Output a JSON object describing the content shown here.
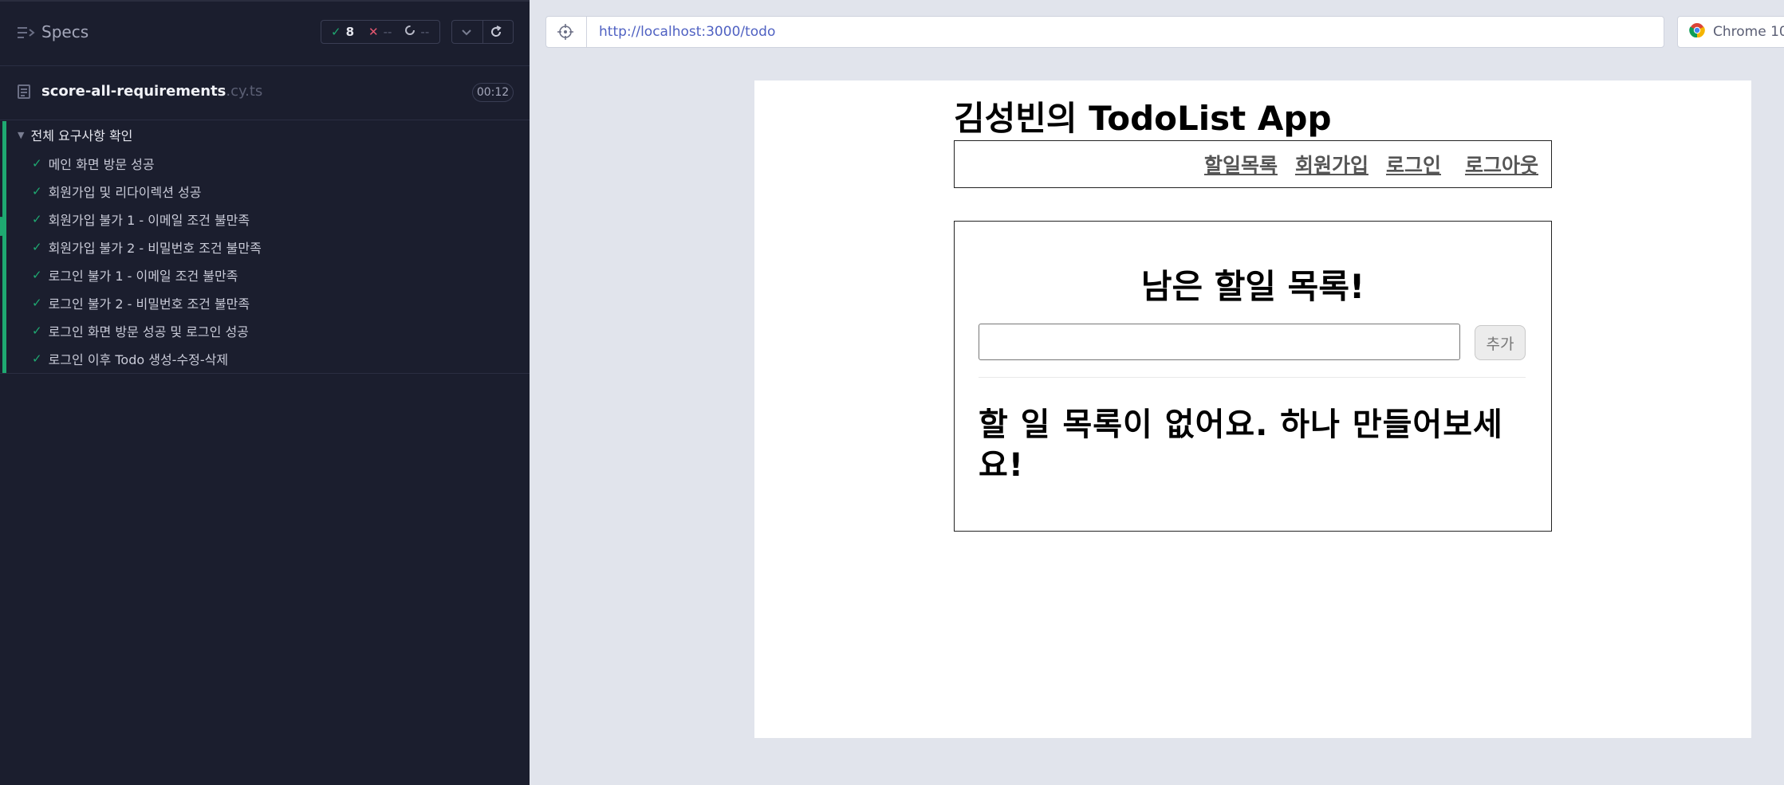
{
  "runner": {
    "specs_title": "Specs",
    "stats": {
      "passed": "8",
      "failed": "--",
      "pending": "--"
    },
    "spec_file": {
      "name": "score-all-requirements",
      "ext": ".cy.ts",
      "duration": "00:12"
    },
    "suite": {
      "title": "전체 요구사항 확인",
      "tests": [
        "메인 화면 방문 성공",
        "회원가입 및 리다이렉션 성공",
        "회원가입 불가 1 - 이메일 조건 불만족",
        "회원가입 불가 2 - 비밀번호 조건 불만족",
        "로그인 불가 1 - 이메일 조건 불만족",
        "로그인 불가 2 - 비밀번호 조건 불만족",
        "로그인 화면 방문 성공 및 로그인 성공",
        "로그인 이후 Todo 생성-수정-삭제"
      ]
    },
    "colors": {
      "pass": "#1fa971",
      "fail": "#e45770",
      "panel_bg": "#1b1e2e"
    }
  },
  "browser": {
    "url": "http://localhost:3000/todo",
    "name": "Chrome 10"
  },
  "app": {
    "title": "김성빈의 TodoList App",
    "nav": {
      "todos": "할일목록",
      "signup": "회원가입",
      "login": "로그인",
      "logout": "로그아웃"
    },
    "heading": "남은 할일 목록!",
    "input_value": "",
    "add_button": "추가",
    "empty_message": "할 일 목록이 없어요. 하나 만들어보세요!"
  }
}
